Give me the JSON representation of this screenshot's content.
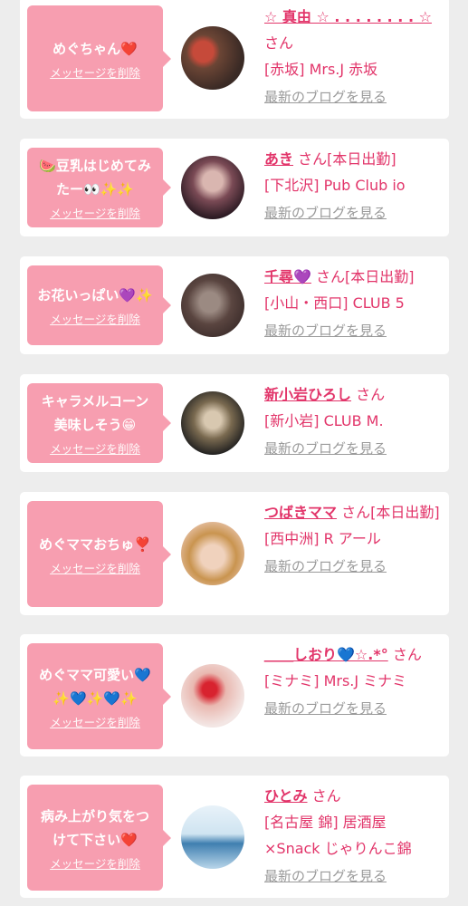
{
  "items": [
    {
      "bubble": "めぐちゃん❤️",
      "delete": "メッセージを削除",
      "name": "☆ 真由 ☆ . . . . . . . . ☆",
      "suffix": "さん",
      "shop": "[赤坂] Mrs.J 赤坂",
      "blog": "最新のブログを見る",
      "avatar_colors": [
        "#3a2a25",
        "#c64a3a"
      ]
    },
    {
      "bubble": "🍉豆乳はじめてみたー👀✨✨",
      "delete": "メッセージを削除",
      "name": "あき",
      "suffix": "さん[本日出勤]",
      "shop": "[下北沢] Pub Club io",
      "blog": "最新のブログを見る",
      "avatar_colors": [
        "#2b1a22",
        "#b9868a"
      ]
    },
    {
      "bubble": "お花いっぱい💜✨",
      "delete": "メッセージを削除",
      "name": "千尋💜",
      "suffix": "さん[本日出勤]",
      "shop": "[小山・西口] CLUB 5",
      "blog": "最新のブログを見る",
      "avatar_colors": [
        "#3b2c2a",
        "#9b8a82"
      ]
    },
    {
      "bubble": "キャラメルコーン美味しそう😁",
      "delete": "メッセージを削除",
      "name": "新小岩ひろし",
      "suffix": "さん",
      "shop": "[新小岩] CLUB M.",
      "blog": "最新のブログを見る",
      "avatar_colors": [
        "#1f1f1f",
        "#7a6a50"
      ]
    },
    {
      "bubble": "めぐママおちゅ❣️",
      "delete": "メッセージを削除",
      "name": "つばきママ",
      "suffix": "さん[本日出勤]",
      "shop": "[西中洲] R アール",
      "blog": "最新のブログを見る",
      "avatar_colors": [
        "#e7c2a8",
        "#b8793c"
      ]
    },
    {
      "bubble": "めぐママ可愛い💙✨💙✨💙✨",
      "delete": "メッセージを削除",
      "name": "＿＿しおり💙☆.*°",
      "suffix": "さん",
      "shop": "[ミナミ] Mrs.J ミナミ",
      "blog": "最新のブログを見る",
      "avatar_colors": [
        "#f3e6e4",
        "#d8232f"
      ]
    },
    {
      "bubble": "病み上がり気をつけて下さい❤️",
      "delete": "メッセージを削除",
      "name": "ひとみ",
      "suffix": "さん",
      "shop": "[名古屋 錦] 居酒屋×Snack じゃりんこ錦",
      "blog": "最新のブログを見る",
      "avatar_colors": [
        "#cfe4f1",
        "#3f7fb0"
      ]
    }
  ]
}
